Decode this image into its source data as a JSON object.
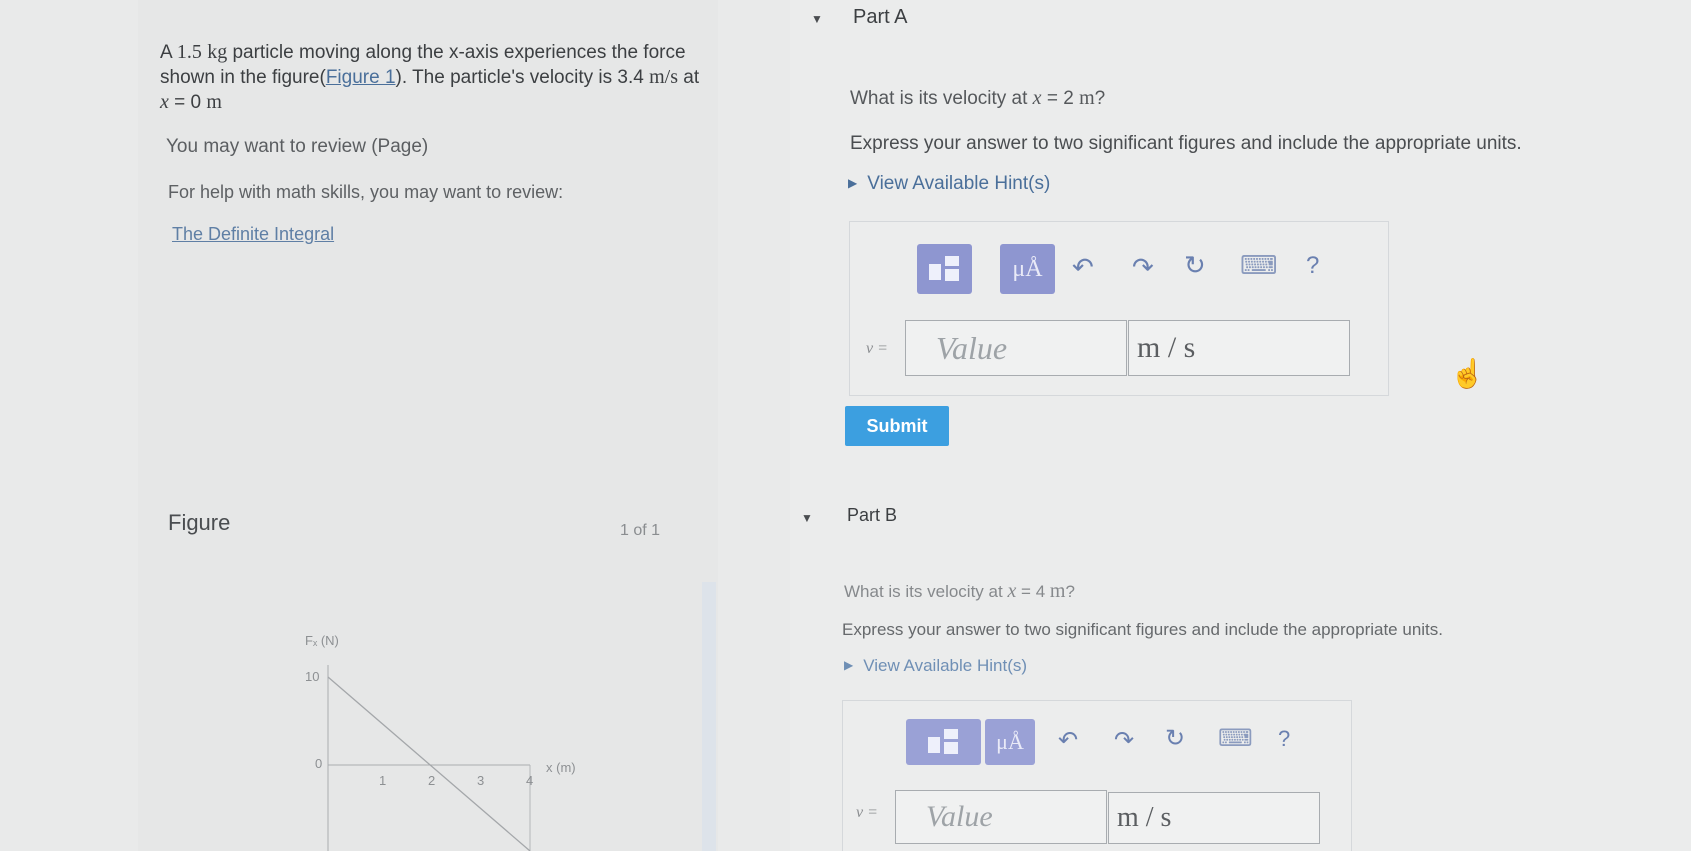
{
  "problem": {
    "mass": "1.5",
    "mass_unit": "kg",
    "text_a": " particle moving along the x-axis experiences the force shown in the figure(",
    "figure_link": "Figure 1",
    "text_b": "). The particle's velocity is ",
    "velocity": "3.4",
    "velocity_unit": "m/s",
    "text_c": " at ",
    "var_x": "x",
    "eq_zero": " = 0 ",
    "unit_m": "m",
    "review": "You may want to review (Page)",
    "math_help": "For help with math skills, you may want to review:",
    "definite_integral": "The Definite Integral"
  },
  "figure": {
    "title": "Figure",
    "count": "1 of 1",
    "y_label": "Fₓ (N)",
    "y_tick_10": "10",
    "origin": "0",
    "x_ticks": [
      "1",
      "2",
      "3",
      "4"
    ],
    "x_label": "x (m)"
  },
  "part_a": {
    "toggle_icon": "▼",
    "title": "Part A",
    "question_pre": "What is its velocity at ",
    "var": "x",
    "question_eq": " = 2 ",
    "question_unit": "m",
    "question_end": "?",
    "instructions": "Express your answer to two significant figures and include the appropriate units.",
    "hint": "View Available Hint(s)",
    "hint_arrow": "▶",
    "mu_label": "μÅ",
    "help": "?",
    "undo": "↶",
    "redo": "↷",
    "reset": "↻",
    "keyboard": "⌨",
    "v_label": "v =",
    "value_placeholder": "Value",
    "unit_value": "m / s",
    "submit": "Submit"
  },
  "part_b": {
    "toggle_icon": "▼",
    "title": "Part B",
    "question_pre": "What is its velocity at ",
    "var": "x",
    "question_eq": " = 4 ",
    "question_unit": "m",
    "question_end": "?",
    "instructions": "Express your answer to two significant figures and include the appropriate units.",
    "hint": "View Available Hint(s)",
    "hint_arrow": "▶",
    "mu_label": "μÅ",
    "help": "?",
    "undo": "↶",
    "redo": "↷",
    "reset": "↻",
    "keyboard": "⌨",
    "v_label": "v =",
    "value_placeholder": "Value",
    "unit_value": "m / s"
  },
  "colors": {
    "accent": "#3c9fe0",
    "toolbar": "#8e96d0",
    "link": "#4a6f9a"
  }
}
